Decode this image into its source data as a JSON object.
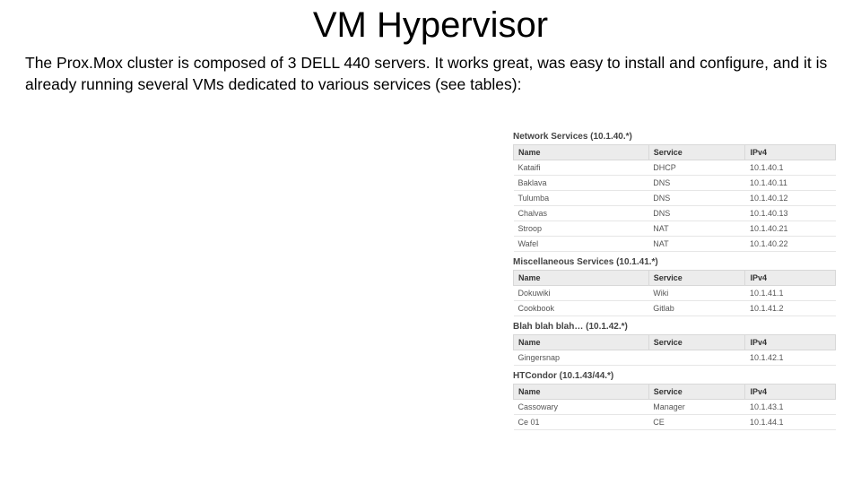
{
  "title": "VM Hypervisor",
  "intro": "The Prox.Mox cluster is composed of 3 DELL 440 servers. It works great, was easy to install and configure, and it is already running several VMs dedicated to various services (see tables):",
  "columns": {
    "name": "Name",
    "service": "Service",
    "ipv4": "IPv4"
  },
  "groups": [
    {
      "title": "Network Services (10.1.40.*)",
      "rows": [
        {
          "name": "Kataifi",
          "service": "DHCP",
          "ipv4": "10.1.40.1"
        },
        {
          "name": "Baklava",
          "service": "DNS",
          "ipv4": "10.1.40.11"
        },
        {
          "name": "Tulumba",
          "service": "DNS",
          "ipv4": "10.1.40.12"
        },
        {
          "name": "Chalvas",
          "service": "DNS",
          "ipv4": "10.1.40.13"
        },
        {
          "name": "Stroop",
          "service": "NAT",
          "ipv4": "10.1.40.21"
        },
        {
          "name": "Wafel",
          "service": "NAT",
          "ipv4": "10.1.40.22"
        }
      ]
    },
    {
      "title": "Miscellaneous Services (10.1.41.*)",
      "rows": [
        {
          "name": "Dokuwiki",
          "service": "Wiki",
          "ipv4": "10.1.41.1"
        },
        {
          "name": "Cookbook",
          "service": "Gitlab",
          "ipv4": "10.1.41.2"
        }
      ]
    },
    {
      "title": "Blah blah blah… (10.1.42.*)",
      "rows": [
        {
          "name": "Gingersnap",
          "service": "",
          "ipv4": "10.1.42.1"
        }
      ]
    },
    {
      "title": "HTCondor (10.1.43/44.*)",
      "rows": [
        {
          "name": "Cassowary",
          "service": "Manager",
          "ipv4": "10.1.43.1"
        },
        {
          "name": "Ce 01",
          "service": "CE",
          "ipv4": "10.1.44.1"
        }
      ]
    }
  ]
}
